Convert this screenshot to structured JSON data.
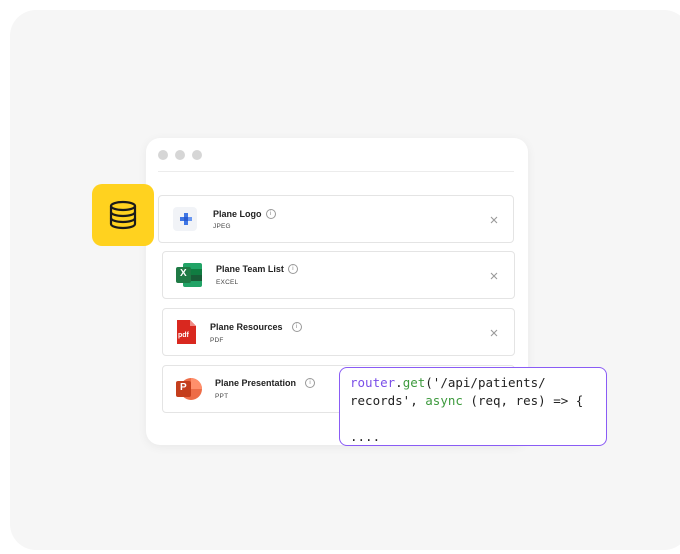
{
  "colors": {
    "canvas_bg": "#f6f6f6",
    "badge_yellow": "#ffd21f",
    "code_border": "#8a5cf5",
    "code_function": "#7a4ee8",
    "code_keyword": "#3d9a3d",
    "excel_green": "#1f7a45",
    "pdf_red": "#d9281f",
    "ppt_orange": "#e0522a",
    "logo_blue": "#3f76e4"
  },
  "badge": {
    "icon": "database-icon"
  },
  "window": {
    "controls": [
      "window-dot",
      "window-dot",
      "window-dot"
    ]
  },
  "files": [
    {
      "name": "Plane Logo",
      "type": "JPEG",
      "icon": "plane-logo-icon",
      "info_icon": "i",
      "closable": true
    },
    {
      "name": "Plane Team List",
      "type": "EXCEL",
      "icon": "excel-icon",
      "info_icon": "i",
      "closable": true
    },
    {
      "name": "Plane Resources",
      "type": "PDF",
      "icon": "pdf-icon",
      "icon_label": "pdf",
      "info_icon": "i",
      "closable": true
    },
    {
      "name": "Plane Presentation",
      "type": "PPT",
      "icon": "powerpoint-icon",
      "info_icon": "i",
      "closable": false
    }
  ],
  "icon_labels": {
    "excel": "X",
    "powerpoint": "P"
  },
  "code": {
    "line1": {
      "obj": "router",
      "dot": ".",
      "fn": "get",
      "args": "('/api/patients/"
    },
    "line2": {
      "cont": "records', ",
      "kw": "async",
      "rest": " (req, res) => {"
    },
    "line3": "",
    "line4": "...."
  }
}
